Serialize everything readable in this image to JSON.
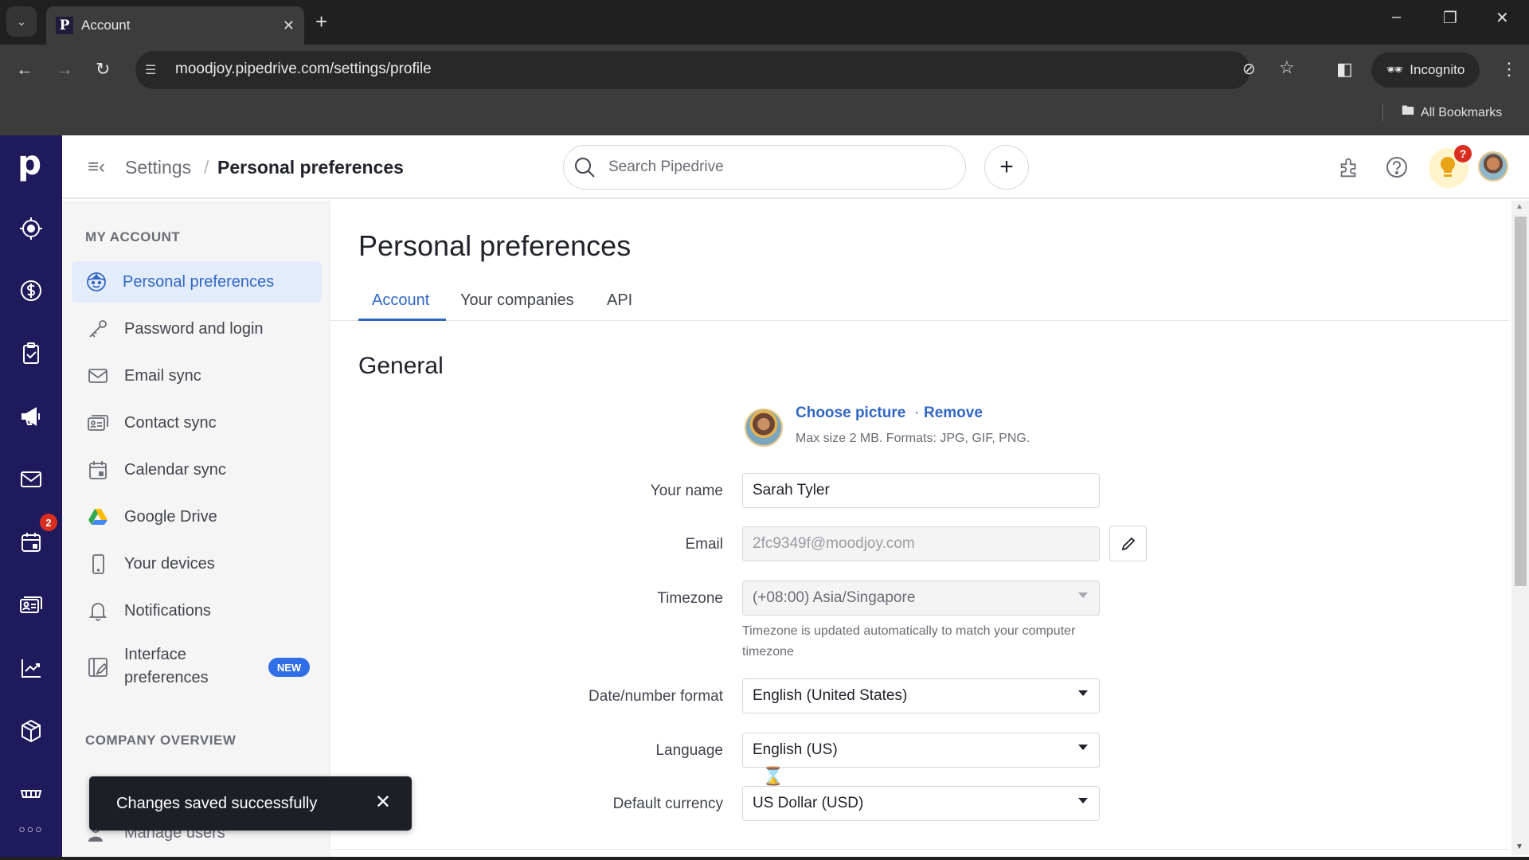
{
  "browser": {
    "tab_title": "Account",
    "tab_favicon": "P",
    "url": "moodjoy.pipedrive.com/settings/profile",
    "incognito_label": "Incognito",
    "all_bookmarks_label": "All Bookmarks"
  },
  "app": {
    "logo": "p",
    "left_nav": [
      {
        "icon": "target-icon"
      },
      {
        "icon": "dollar-icon"
      },
      {
        "icon": "clipboard-check-icon"
      },
      {
        "icon": "megaphone-icon"
      },
      {
        "icon": "mail-icon"
      },
      {
        "icon": "calendar-icon",
        "badge": "2"
      },
      {
        "icon": "contacts-icon"
      },
      {
        "icon": "chart-icon"
      },
      {
        "icon": "box-icon"
      },
      {
        "icon": "marketplace-icon"
      },
      {
        "icon": "more-icon"
      }
    ]
  },
  "header": {
    "breadcrumb_root": "Settings",
    "breadcrumb_sep": "/",
    "breadcrumb_current": "Personal preferences",
    "search_placeholder": "Search Pipedrive",
    "add_label": "+",
    "tips_badge": "?"
  },
  "sidebar": {
    "section1": "MY ACCOUNT",
    "items": [
      {
        "label": "Personal preferences",
        "icon": "face-icon",
        "active": true
      },
      {
        "label": "Password and login",
        "icon": "key-icon"
      },
      {
        "label": "Email sync",
        "icon": "mail-icon"
      },
      {
        "label": "Contact sync",
        "icon": "contact-card-icon"
      },
      {
        "label": "Calendar sync",
        "icon": "calendar-icon"
      },
      {
        "label": "Google Drive",
        "icon": "google-drive-icon"
      },
      {
        "label": "Your devices",
        "icon": "phone-icon"
      },
      {
        "label": "Notifications",
        "icon": "bell-icon"
      },
      {
        "label": "Interface preferences",
        "label_line1": "Interface",
        "label_line2": "preferences",
        "icon": "interface-edit-icon",
        "badge": "NEW"
      }
    ],
    "section2": "COMPANY OVERVIEW",
    "company_items": [
      {
        "label": "Manage users",
        "icon": "users-icon"
      }
    ]
  },
  "main": {
    "title": "Personal preferences",
    "tabs": [
      {
        "label": "Account",
        "active": true
      },
      {
        "label": "Your companies"
      },
      {
        "label": "API"
      }
    ],
    "section_title": "General",
    "picture": {
      "choose_label": "Choose picture",
      "separator": "·",
      "remove_label": "Remove",
      "hint": "Max size 2 MB. Formats: JPG, GIF, PNG."
    },
    "fields": {
      "name": {
        "label": "Your name",
        "value": "Sarah Tyler"
      },
      "email": {
        "label": "Email",
        "value": "2fc9349f@moodjoy.com"
      },
      "timezone": {
        "label": "Timezone",
        "value": "(+08:00) Asia/Singapore",
        "hint": "Timezone is updated automatically to match your computer timezone"
      },
      "date_format": {
        "label": "Date/number format",
        "value": "English (United States)"
      },
      "language": {
        "label": "Language",
        "value": "English (US)"
      },
      "currency": {
        "label": "Default currency",
        "value": "US Dollar (USD)"
      }
    }
  },
  "toast": {
    "message": "Changes saved successfully"
  },
  "colors": {
    "brand_nav": "#1f1a5c",
    "accent": "#3167c4",
    "badge_red": "#d92d20",
    "new_badge": "#2f6ee6",
    "toast_bg": "#1d1f27"
  }
}
